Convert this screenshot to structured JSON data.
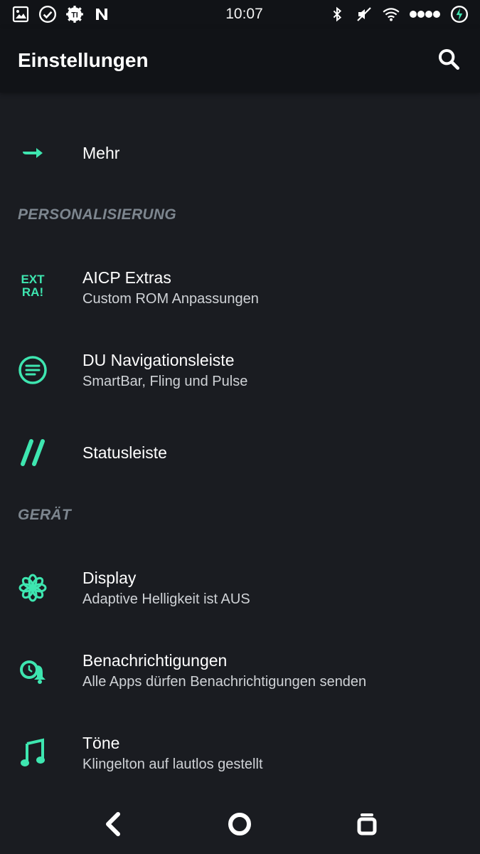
{
  "status_bar": {
    "time": "10:07",
    "left_icons": [
      "image-icon",
      "check-circle-icon",
      "gear-badge-icon",
      "n-icon"
    ],
    "right_icons": [
      "bluetooth-icon",
      "muted-icon",
      "wifi-icon",
      "signal-dots-icon",
      "battery-icon"
    ]
  },
  "toolbar": {
    "title": "Einstellungen",
    "search_icon": "search-icon"
  },
  "items": {
    "more": {
      "title": "Mehr",
      "icon": "arrow-right-icon"
    },
    "section_personalization": "PERSONALISIERUNG",
    "aicp": {
      "title": "AICP Extras",
      "subtitle": "Custom ROM Anpassungen",
      "icon": "extra-icon",
      "icon_text_top": "EXT",
      "icon_text_bottom": "RA!"
    },
    "du_nav": {
      "title": "DU Navigationsleiste",
      "subtitle": "SmartBar, Fling und Pulse",
      "icon": "lines-circle-icon"
    },
    "statusbar": {
      "title": "Statusleiste",
      "icon": "double-slash-icon"
    },
    "section_device": "GERÄT",
    "display": {
      "title": "Display",
      "subtitle": "Adaptive Helligkeit ist AUS",
      "icon": "flower-icon"
    },
    "notifications": {
      "title": "Benachrichtigungen",
      "subtitle": "Alle Apps dürfen Benachrichtigungen senden",
      "icon": "alarm-bell-icon"
    },
    "sounds": {
      "title": "Töne",
      "subtitle": "Klingelton auf lautlos gestellt",
      "icon": "music-note-icon"
    }
  },
  "nav_bar": {
    "back_icon": "back-icon",
    "home_icon": "home-icon",
    "recents_icon": "recents-icon"
  },
  "colors": {
    "background": "#1a1c21",
    "bar": "#111317",
    "accent": "#3ee6b0",
    "section_header": "#7d868f"
  }
}
